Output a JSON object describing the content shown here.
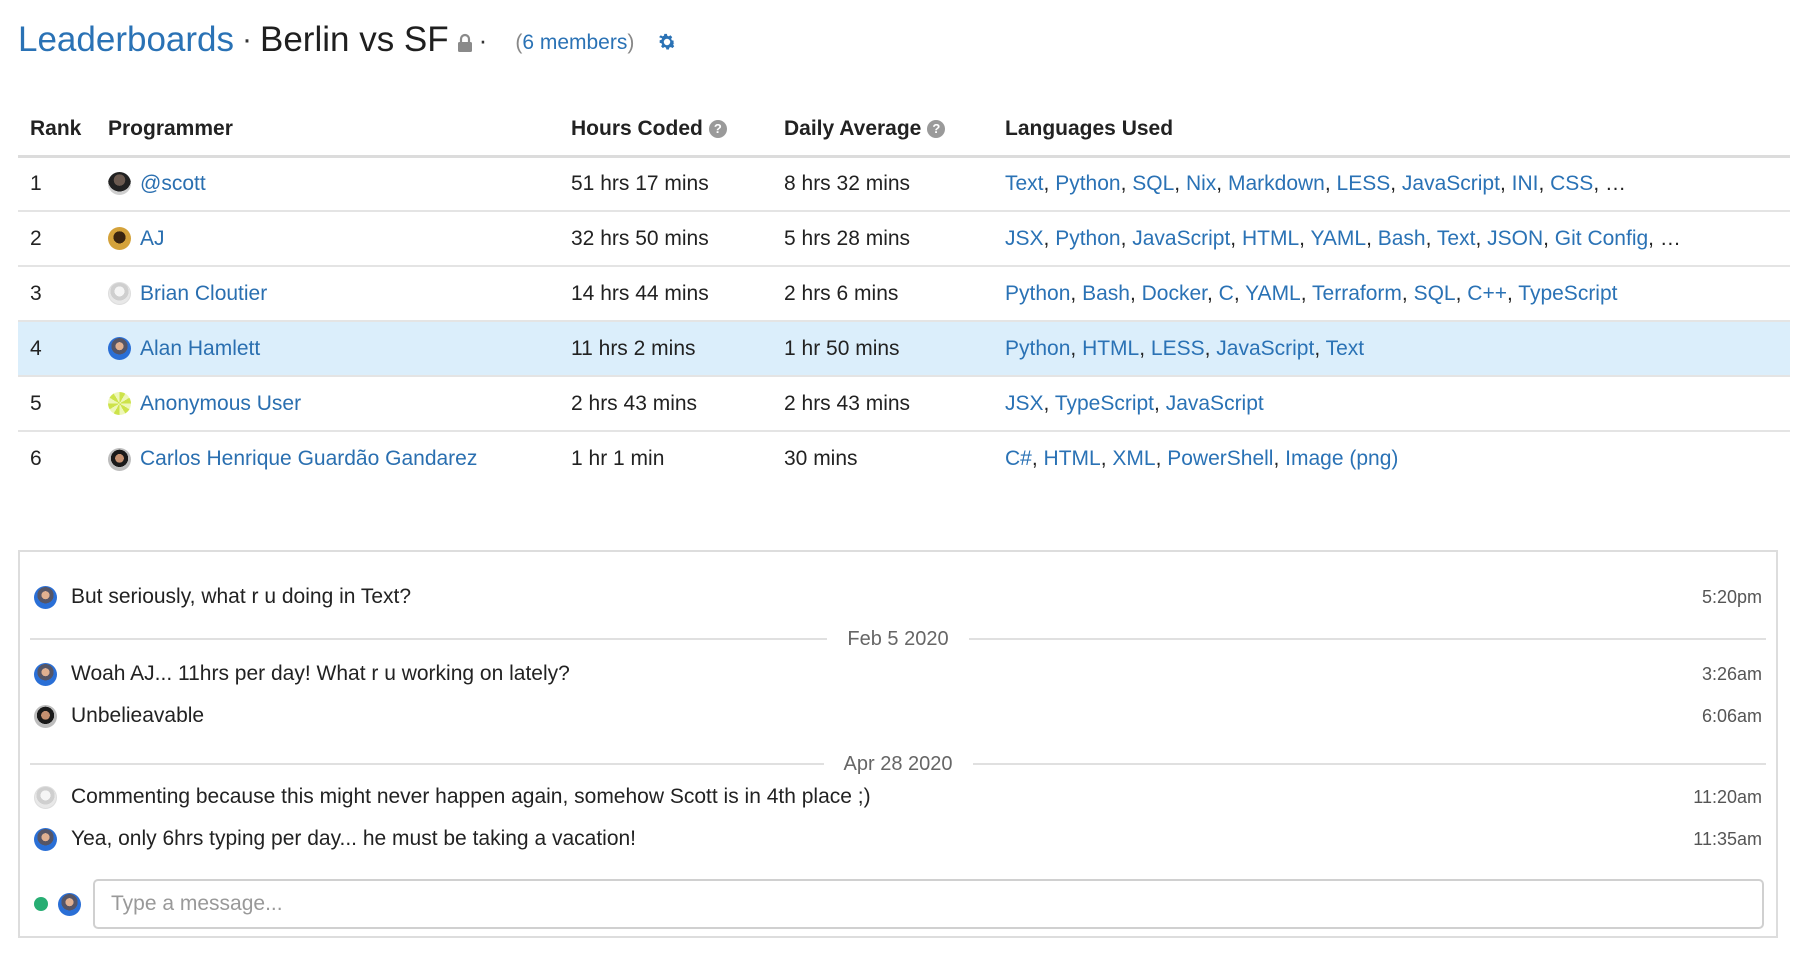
{
  "header": {
    "breadcrumb": "Leaderboards",
    "separator": "·",
    "title": "Berlin vs SF",
    "lock_icon": "lock-icon",
    "trailing_separator": "·",
    "members_open": "(",
    "members_link": "6 members",
    "members_close": ")",
    "settings_icon": "gear-icon"
  },
  "table": {
    "columns": [
      "Rank",
      "Programmer",
      "Hours Coded",
      "Daily Average",
      "Languages Used"
    ],
    "help_icon": "?",
    "rows": [
      {
        "rank": "1",
        "name": "@scott",
        "avatar": "avatar-scott",
        "hours": "51 hrs 17 mins",
        "daily": "8 hrs 32 mins",
        "languages": [
          "Text",
          "Python",
          "SQL",
          "Nix",
          "Markdown",
          "LESS",
          "JavaScript",
          "INI",
          "CSS"
        ],
        "more": "…",
        "highlighted": false
      },
      {
        "rank": "2",
        "name": "AJ",
        "avatar": "avatar-aj",
        "hours": "32 hrs 50 mins",
        "daily": "5 hrs 28 mins",
        "languages": [
          "JSX",
          "Python",
          "JavaScript",
          "HTML",
          "YAML",
          "Bash",
          "Text",
          "JSON",
          "Git Config"
        ],
        "more": "…",
        "highlighted": false
      },
      {
        "rank": "3",
        "name": "Brian Cloutier",
        "avatar": "avatar-brian",
        "hours": "14 hrs 44 mins",
        "daily": "2 hrs 6 mins",
        "languages": [
          "Python",
          "Bash",
          "Docker",
          "C",
          "YAML",
          "Terraform",
          "SQL",
          "C++",
          "TypeScript"
        ],
        "more": "",
        "highlighted": false
      },
      {
        "rank": "4",
        "name": "Alan Hamlett",
        "avatar": "avatar-alan",
        "hours": "11 hrs 2 mins",
        "daily": "1 hr 50 mins",
        "languages": [
          "Python",
          "HTML",
          "LESS",
          "JavaScript",
          "Text"
        ],
        "more": "",
        "highlighted": true
      },
      {
        "rank": "5",
        "name": "Anonymous User",
        "avatar": "avatar-anon",
        "hours": "2 hrs 43 mins",
        "daily": "2 hrs 43 mins",
        "languages": [
          "JSX",
          "TypeScript",
          "JavaScript"
        ],
        "more": "",
        "highlighted": false
      },
      {
        "rank": "6",
        "name": "Carlos Henrique Guardão Gandarez",
        "avatar": "avatar-carlos",
        "hours": "1 hr 1 min",
        "daily": "30 mins",
        "languages": [
          "C#",
          "HTML",
          "XML",
          "PowerShell",
          "Image (png)"
        ],
        "more": "",
        "highlighted": false
      }
    ]
  },
  "chat": {
    "messages": [
      {
        "avatar": "avatar-alan",
        "text": "But seriously, what r u doing in Text?",
        "time": "5:20pm"
      },
      {
        "divider": "Feb 5 2020"
      },
      {
        "avatar": "avatar-alan",
        "text": "Woah AJ... 11hrs per day! What r u working on lately?",
        "time": "3:26am"
      },
      {
        "avatar": "avatar-carlos",
        "text": "Unbelieavable",
        "time": "6:06am"
      },
      {
        "divider": "Apr 28 2020"
      },
      {
        "avatar": "avatar-brian",
        "text": "Commenting because this might never happen again, somehow Scott is in 4th place ;)",
        "time": "11:20am"
      },
      {
        "avatar": "avatar-alan",
        "text": "Yea, only 6hrs typing per day... he must be taking a vacation!",
        "time": "11:35am"
      }
    ],
    "input_placeholder": "Type a message...",
    "input_value": "",
    "status": "online"
  },
  "colors": {
    "link": "#2a72b5",
    "highlight_row": "#dbeefb",
    "online": "#27ae73"
  }
}
